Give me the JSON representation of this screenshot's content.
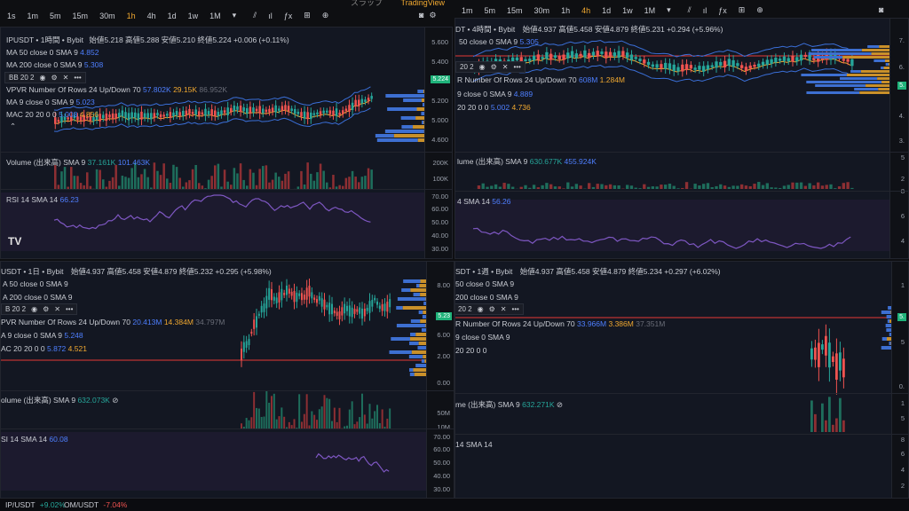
{
  "top_chars": "スラップ",
  "tv_brand": "TradingView",
  "left_bar": {
    "intervals": [
      "1s",
      "1m",
      "5m",
      "15m",
      "30m",
      "1h",
      "4h",
      "1d",
      "1w",
      "1M"
    ],
    "active": "1h"
  },
  "right_bar": {
    "intervals": [
      "1m",
      "5m",
      "15m",
      "30m",
      "1h",
      "4h",
      "1d",
      "1w",
      "1M"
    ],
    "active": "4h"
  },
  "panes": {
    "p1": {
      "title": "IPUSDT • 1時間 • Bybit",
      "ohlc": "始値5.218 高値5.288 安値5.210 終値5.224 +0.006 (+0.11%)",
      "ma50": "MA 50 close 0 SMA 9",
      "ma50v": "4.852",
      "ma200": "MA 200 close 0 SMA 9",
      "ma200v": "5.308",
      "bb": "BB 20 2",
      "vpvr": "VPVR Number Of Rows 24 Up/Down 70",
      "vpvr1": "57.802K",
      "vpvr2": "29.15K",
      "vpvr3": "86.952K",
      "ma9": "MA 9 close 0 SMA 9",
      "ma9v": "5.023",
      "macd": "MAC 20 20 0 0",
      "macd1": "5.008",
      "macd2": "4.856",
      "price": "5.224",
      "ticks": [
        "5.600",
        "5.400",
        "5.200",
        "5.000",
        "4.800",
        "4.600"
      ],
      "vol": "Volume (出来高) SMA 9",
      "vol1": "37.161K",
      "vol2": "101.463K",
      "vol_ticks": [
        "200K",
        "100K"
      ],
      "rsi": "RSI 14 SMA 14",
      "rsiv": "66.23",
      "rsi_ticks": [
        "70.00",
        "60.00",
        "50.00",
        "40.00",
        "30.00"
      ]
    },
    "p2": {
      "title": "DT • 4時間 • Bybit",
      "ohlc": "始値4.937 高値5.458 安値4.879 終値5.231 +0.294 (+5.96%)",
      "ma50": "50 close 0 SMA 9",
      "ma50v": "5.305",
      "bb": "20 2",
      "vpvr": "R Number Of Rows 24 Up/Down 70",
      "vpvr1": "608M",
      "vpvr2": "1.284M",
      "ma9": "9 close 0 SMA 9",
      "ma9v": "4.889",
      "macd": "20 20 0 0",
      "macd1": "5.002",
      "macd2": "4.736",
      "ticks": [
        "7.",
        "6.",
        "5.",
        "4.",
        "3."
      ],
      "vol": "lume (出来高) SMA 9",
      "vol1": "630.677K",
      "vol2": "455.924K",
      "vol_ticks": [
        "5",
        "2"
      ],
      "rsi": "4 SMA 14",
      "rsiv": "56.26",
      "rsi_ticks": [
        "8",
        "6",
        "4"
      ]
    },
    "p3": {
      "title": "USDT • 1日 • Bybit",
      "ohlc": "始値4.937 高値5.458 安値4.879 終値5.232 +0.295 (+5.98%)",
      "ma50": "A 50 close 0 SMA 9",
      "ma200": "A 200 close 0 SMA 9",
      "bb": "B 20 2",
      "vpvr": "PVR Number Of Rows 24 Up/Down 70",
      "vpvr1": "20.413M",
      "vpvr2": "14.384M",
      "vpvr3": "34.797M",
      "ma9": "A 9 close 0 SMA 9",
      "ma9v": "5.248",
      "macd": "AC 20 20 0 0",
      "macd1": "5.872",
      "macd2": "4.521",
      "price": "5.23",
      "ticks": [
        "8.00",
        "6.00",
        "4.00",
        "2.00",
        "0.00"
      ],
      "vol": "olume (出来高) SMA 9",
      "vol1": "632.073K",
      "vol_ticks": [
        "50M",
        "10M"
      ],
      "rsi": "SI 14 SMA 14",
      "rsiv": "60.08",
      "rsi_ticks": [
        "70.00",
        "60.00",
        "50.00",
        "40.00",
        "30.00"
      ]
    },
    "p4": {
      "title": "SDT • 1週 • Bybit",
      "ohlc": "始値4.937 高値5.458 安値4.879 終値5.234 +0.297 (+6.02%)",
      "ma50": "50 close 0 SMA 9",
      "ma200": "200 close 0 SMA 9",
      "bb": "20 2",
      "vpvr": "R Number Of Rows 24 Up/Down 70",
      "vpvr1": "33.966M",
      "vpvr2": "3.386M",
      "vpvr3": "37.351M",
      "ma9": "9 close 0 SMA 9",
      "macd": "20 20 0 0",
      "price": "5.",
      "ticks": [
        "1",
        "5",
        "0."
      ],
      "vol": "me (出来高) SMA 9",
      "vol1": "632.271K",
      "vol_ticks": [
        "1",
        "5"
      ],
      "rsi": "14 SMA 14",
      "rsi_ticks": [
        "8",
        "6",
        "4",
        "2"
      ]
    }
  },
  "footer": {
    "sym1": "IP/USDT",
    "chg1": "+9.02%",
    "sym2": "OM/USDT",
    "chg2": "-7.04%"
  },
  "colors": {
    "up": "#26a69a",
    "down": "#ef5350",
    "accent": "#f0a830",
    "blue": "#4e7fff",
    "rsi": "#7e57c2"
  }
}
